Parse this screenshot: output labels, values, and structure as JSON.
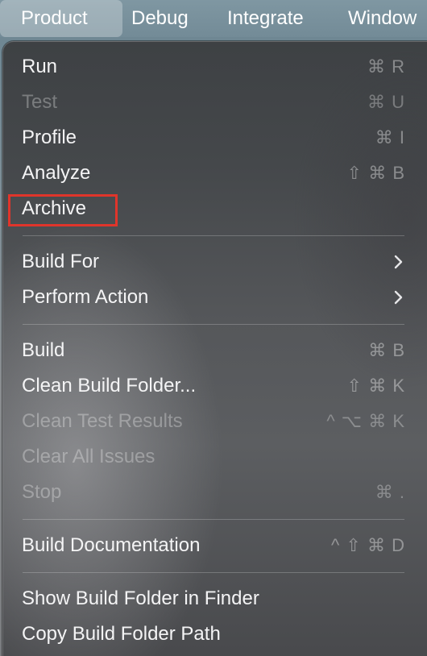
{
  "menubar": {
    "items": [
      {
        "label": "Product"
      },
      {
        "label": "Debug"
      },
      {
        "label": "Integrate"
      },
      {
        "label": "Window"
      }
    ]
  },
  "menu": {
    "items": [
      {
        "label": "Run",
        "shortcut": "⌘ R",
        "enabled": true
      },
      {
        "label": "Test",
        "shortcut": "⌘ U",
        "enabled": false
      },
      {
        "label": "Profile",
        "shortcut": "⌘ I",
        "enabled": true
      },
      {
        "label": "Analyze",
        "shortcut": "⇧ ⌘ B",
        "enabled": true
      },
      {
        "label": "Archive",
        "shortcut": "",
        "enabled": true,
        "highlighted": true
      },
      {
        "label": "Build For",
        "submenu": true,
        "enabled": true
      },
      {
        "label": "Perform Action",
        "submenu": true,
        "enabled": true
      },
      {
        "label": "Build",
        "shortcut": "⌘ B",
        "enabled": true
      },
      {
        "label": "Clean Build Folder...",
        "shortcut": "⇧ ⌘ K",
        "enabled": true
      },
      {
        "label": "Clean Test Results",
        "shortcut": "^ ⌥ ⌘ K",
        "enabled": false
      },
      {
        "label": "Clear All Issues",
        "shortcut": "",
        "enabled": false
      },
      {
        "label": "Stop",
        "shortcut": "⌘ .",
        "enabled": false
      },
      {
        "label": "Build Documentation",
        "shortcut": "^ ⇧ ⌘ D",
        "enabled": true
      },
      {
        "label": "Show Build Folder in Finder",
        "shortcut": "",
        "enabled": true
      },
      {
        "label": "Copy Build Folder Path",
        "shortcut": "",
        "enabled": true
      }
    ]
  },
  "colors": {
    "highlight_box": "#e0352b",
    "enabled_text": "#f4f4f5",
    "disabled_text": "rgba(255,255,255,0.30)"
  }
}
